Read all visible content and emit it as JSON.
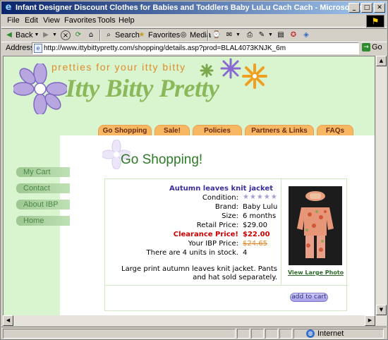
{
  "window": {
    "title": "Infant Designer Discount Clothes for Babies and Toddlers Baby LuLu Cach Cach - Microsoft Internet Explorer"
  },
  "menu": [
    "File",
    "Edit",
    "View",
    "Favorites",
    "Tools",
    "Help"
  ],
  "toolbar": {
    "back": "Back",
    "search": "Search",
    "favorites": "Favorites",
    "media": "Media"
  },
  "address": {
    "label": "Address",
    "url": "http://www.ittybittypretty.com/shopping/details.asp?prod=BLAL4073KNJK_6m",
    "go": "Go"
  },
  "site": {
    "tagline": "pretties for your itty bitty",
    "logo": "Itty Bitty Pretty",
    "tabs": [
      "Go Shopping",
      "Sale!",
      "Policies",
      "Partners & Links",
      "FAQs"
    ],
    "nav": [
      "My Cart",
      "Contact",
      "About IBP",
      "Home"
    ],
    "page_title": "Go Shopping!"
  },
  "product": {
    "name": "Autumn leaves knit jacket",
    "condition_label": "Condition:",
    "condition_stars": "★★★★★",
    "brand_label": "Brand:",
    "brand": "Baby Lulu",
    "size_label": "Size:",
    "size": "6 months",
    "retail_label": "Retail Price:",
    "retail": "$29.00",
    "clearance_label": "Clearance Price!",
    "clearance": "$22.00",
    "ibp_label": "Your IBP Price:",
    "ibp": "$24.65",
    "stock_label": "There are 4 units in stock.",
    "stock": "4",
    "description": "Large print autumn leaves knit jacket. Pants and hat sold separately.",
    "photo_link": "View Large Photo",
    "add_to_cart": "add to cart"
  },
  "status": {
    "zone": "Internet"
  },
  "colors": {
    "header_green": "#d8f5cf",
    "tab_orange": "#f7b763",
    "title_green": "#2e7a28",
    "product_name": "#3b2e98",
    "clearance_red": "#cc0000"
  }
}
